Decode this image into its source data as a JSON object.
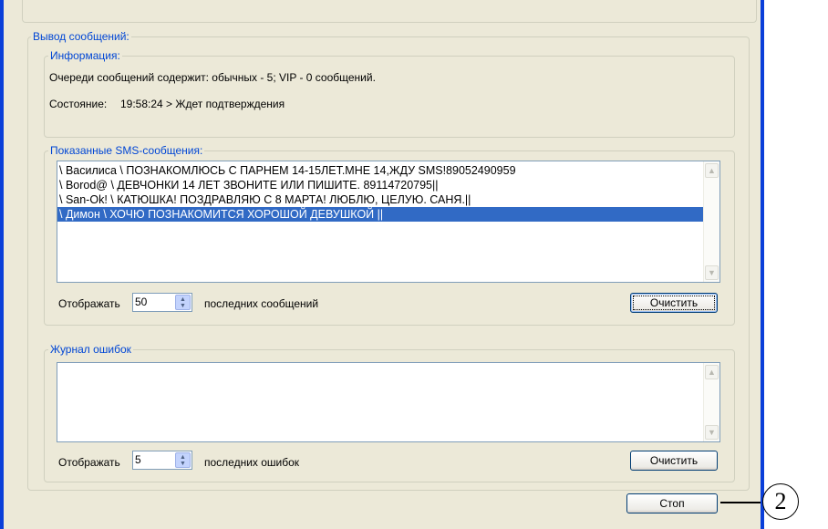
{
  "output": {
    "legend": "Вывод сообщений:"
  },
  "info": {
    "legend": "Информация:",
    "queue_text": "Очереди сообщений содержит: обычных - 5; VIP - 0 сообщений.",
    "state_label": "Состояние:",
    "state_value": "19:58:24 > Ждет подтверждения"
  },
  "sms": {
    "legend": "Показанные SMS-сообщения:",
    "items": [
      "\\ Василиса \\ ПОЗНАКОМЛЮСЬ С ПАРНЕМ 14-15ЛЕТ.МНЕ 14,ЖДУ SMS!89052490959",
      "\\ Borod@ \\ ДЕВЧОНКИ 14 ЛЕТ ЗВОНИТЕ ИЛИ ПИШИТЕ.  89114720795||",
      "\\ San-Ok! \\ КАТЮШКА! ПОЗДРАВЛЯЮ С 8 МАРТА! ЛЮБЛЮ, ЦЕЛУЮ. САНЯ.||",
      "\\ Димон \\ ХОЧЮ ПОЗНАКОМИТСЯ ХОРОШОЙ ДЕВУШКОЙ ||"
    ],
    "selected_index": 3,
    "show_label": "Отображать",
    "count_value": "50",
    "suffix_label": "последних сообщений",
    "clear_label": "Очистить"
  },
  "errors": {
    "legend": "Журнал ошибок",
    "show_label": "Отображать",
    "count_value": "5",
    "suffix_label": "последних ошибок",
    "clear_label": "Очистить"
  },
  "stop_label": "Стоп",
  "callout_number": "2",
  "colors": {
    "window_border": "#0a3fd9",
    "legend_text": "#0046d5",
    "selection": "#316ac5",
    "dialog_bg": "#ece9d8"
  }
}
